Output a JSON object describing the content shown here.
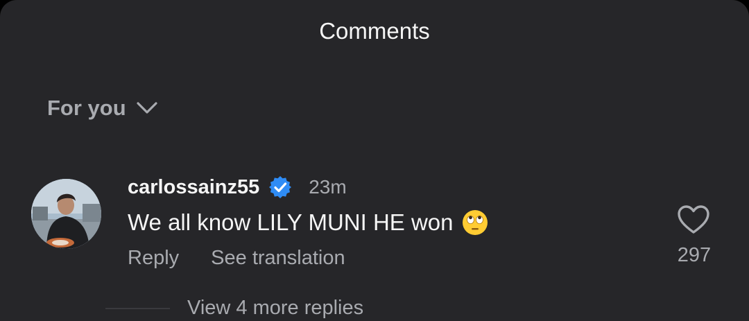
{
  "header": {
    "title": "Comments"
  },
  "sort": {
    "label": "For you",
    "icon": "chevron-down-icon"
  },
  "comment": {
    "username": "carlossainz55",
    "verified": true,
    "time": "23m",
    "text": "We all know LILY MUNI HE won",
    "emoji": "face-with-rolling-eyes",
    "actions": {
      "reply": "Reply",
      "translate": "See translation"
    },
    "likes": "297",
    "view_replies": "View 4 more replies"
  },
  "colors": {
    "background": "#262629",
    "primary_text": "#f5f5f5",
    "secondary_text": "#a9abb0",
    "verified_blue": "#2f8cf5",
    "emoji_yellow": "#ffcc33"
  }
}
